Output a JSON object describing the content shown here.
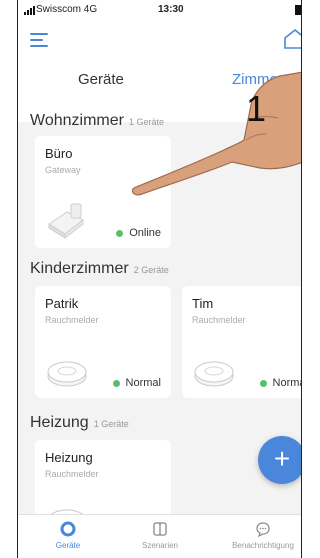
{
  "status_bar": {
    "carrier": "Swisscom  4G",
    "time": "13:30"
  },
  "header": {
    "tabs": [
      {
        "label": "Geräte"
      },
      {
        "label": "Zimmer"
      }
    ]
  },
  "rooms": [
    {
      "name": "Wohnzimmer",
      "count": "1 Geräte",
      "devices": [
        {
          "name": "Büro",
          "type": "Gateway",
          "status": "Online"
        }
      ]
    },
    {
      "name": "Kinderzimmer",
      "count": "2 Geräte",
      "devices": [
        {
          "name": "Patrik",
          "type": "Rauchmelder",
          "status": "Normal"
        },
        {
          "name": "Tim",
          "type": "Rauchmelder",
          "status": "Normal"
        }
      ]
    },
    {
      "name": "Heizung",
      "count": "1 Geräte",
      "devices": [
        {
          "name": "Heizung",
          "type": "Rauchmelder",
          "status": ""
        }
      ]
    }
  ],
  "fab": {
    "label": "+"
  },
  "bottom_nav": [
    {
      "label": "Geräte"
    },
    {
      "label": "Szenarien"
    },
    {
      "label": "Benachrichtigung"
    }
  ],
  "annotation": {
    "step": "1"
  },
  "colors": {
    "accent": "#4a86d9",
    "online": "#5bbf6a",
    "background": "#f3f3f3"
  },
  "icons": [
    "menu-icon",
    "home-icon",
    "gateway-device-icon",
    "smoke-detector-icon",
    "plus-icon",
    "devices-tab-icon",
    "scenes-tab-icon",
    "notification-icon",
    "pointing-hand-icon"
  ]
}
